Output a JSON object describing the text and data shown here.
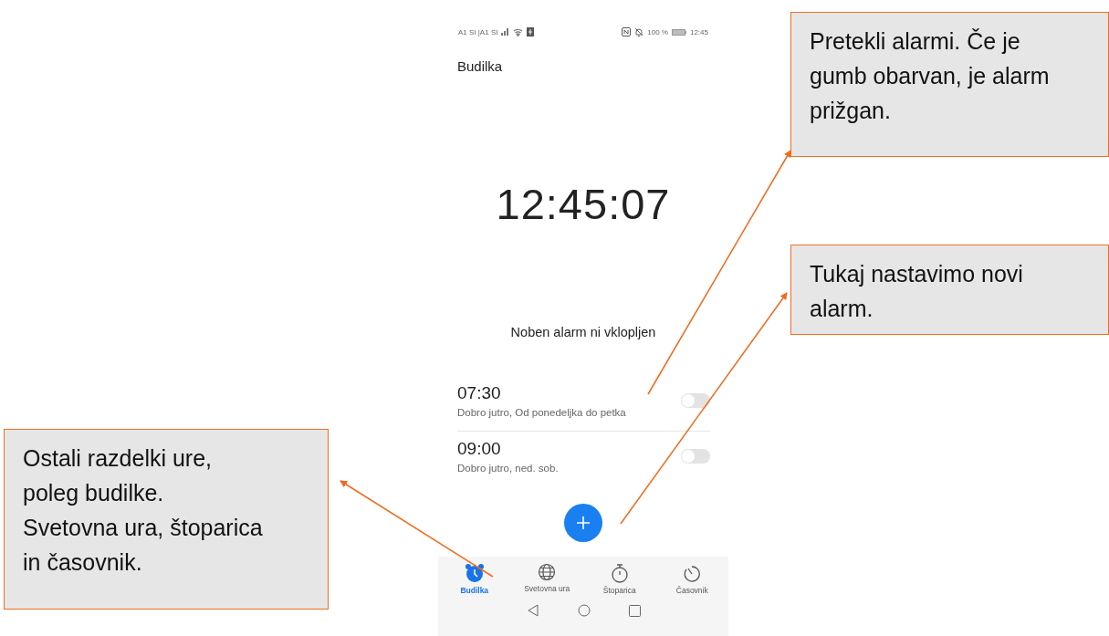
{
  "status_bar": {
    "carrier": "A1 SI |A1 SI",
    "battery_percent": "100 %",
    "time": "12:45"
  },
  "app_title": "Budilka",
  "clock": "12:45:07",
  "alarm_status": "Noben alarm ni vklopljen",
  "alarms": [
    {
      "time": "07:30",
      "label": "Dobro jutro, Od ponedeljka do petka",
      "on": false
    },
    {
      "time": "09:00",
      "label": "Dobro jutro, ned. sob.",
      "on": false
    }
  ],
  "bottom_nav": [
    {
      "label": "Budilka",
      "selected": true
    },
    {
      "label": "Svetovna ura",
      "selected": false
    },
    {
      "label": "Štoparica",
      "selected": false
    },
    {
      "label": "Časovnik",
      "selected": false
    }
  ],
  "callouts": [
    {
      "text": "Pretekli alarmi. Če je gumb obarvan, je alarm prižgan."
    },
    {
      "text": "Tukaj nastavimo novi alarm."
    },
    {
      "text": "Ostali razdelki ure, poleg budilke. Svetovna ura, štoparica in časovnik."
    }
  ]
}
